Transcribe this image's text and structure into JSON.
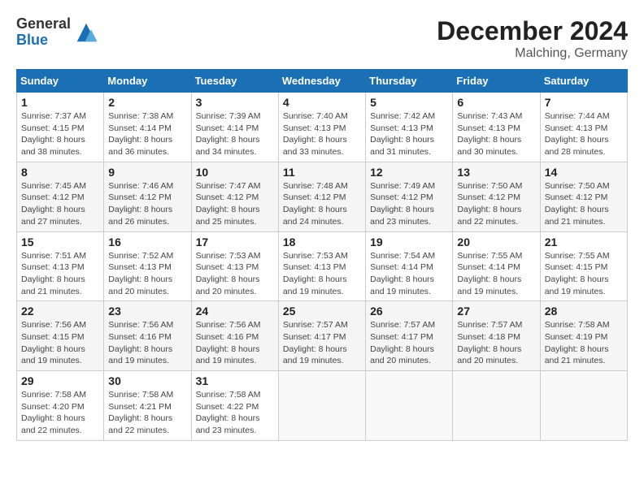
{
  "header": {
    "logo_general": "General",
    "logo_blue": "Blue",
    "month_year": "December 2024",
    "location": "Malching, Germany"
  },
  "days_of_week": [
    "Sunday",
    "Monday",
    "Tuesday",
    "Wednesday",
    "Thursday",
    "Friday",
    "Saturday"
  ],
  "weeks": [
    [
      {
        "day": "1",
        "sunrise": "Sunrise: 7:37 AM",
        "sunset": "Sunset: 4:15 PM",
        "daylight": "Daylight: 8 hours and 38 minutes."
      },
      {
        "day": "2",
        "sunrise": "Sunrise: 7:38 AM",
        "sunset": "Sunset: 4:14 PM",
        "daylight": "Daylight: 8 hours and 36 minutes."
      },
      {
        "day": "3",
        "sunrise": "Sunrise: 7:39 AM",
        "sunset": "Sunset: 4:14 PM",
        "daylight": "Daylight: 8 hours and 34 minutes."
      },
      {
        "day": "4",
        "sunrise": "Sunrise: 7:40 AM",
        "sunset": "Sunset: 4:13 PM",
        "daylight": "Daylight: 8 hours and 33 minutes."
      },
      {
        "day": "5",
        "sunrise": "Sunrise: 7:42 AM",
        "sunset": "Sunset: 4:13 PM",
        "daylight": "Daylight: 8 hours and 31 minutes."
      },
      {
        "day": "6",
        "sunrise": "Sunrise: 7:43 AM",
        "sunset": "Sunset: 4:13 PM",
        "daylight": "Daylight: 8 hours and 30 minutes."
      },
      {
        "day": "7",
        "sunrise": "Sunrise: 7:44 AM",
        "sunset": "Sunset: 4:13 PM",
        "daylight": "Daylight: 8 hours and 28 minutes."
      }
    ],
    [
      {
        "day": "8",
        "sunrise": "Sunrise: 7:45 AM",
        "sunset": "Sunset: 4:12 PM",
        "daylight": "Daylight: 8 hours and 27 minutes."
      },
      {
        "day": "9",
        "sunrise": "Sunrise: 7:46 AM",
        "sunset": "Sunset: 4:12 PM",
        "daylight": "Daylight: 8 hours and 26 minutes."
      },
      {
        "day": "10",
        "sunrise": "Sunrise: 7:47 AM",
        "sunset": "Sunset: 4:12 PM",
        "daylight": "Daylight: 8 hours and 25 minutes."
      },
      {
        "day": "11",
        "sunrise": "Sunrise: 7:48 AM",
        "sunset": "Sunset: 4:12 PM",
        "daylight": "Daylight: 8 hours and 24 minutes."
      },
      {
        "day": "12",
        "sunrise": "Sunrise: 7:49 AM",
        "sunset": "Sunset: 4:12 PM",
        "daylight": "Daylight: 8 hours and 23 minutes."
      },
      {
        "day": "13",
        "sunrise": "Sunrise: 7:50 AM",
        "sunset": "Sunset: 4:12 PM",
        "daylight": "Daylight: 8 hours and 22 minutes."
      },
      {
        "day": "14",
        "sunrise": "Sunrise: 7:50 AM",
        "sunset": "Sunset: 4:12 PM",
        "daylight": "Daylight: 8 hours and 21 minutes."
      }
    ],
    [
      {
        "day": "15",
        "sunrise": "Sunrise: 7:51 AM",
        "sunset": "Sunset: 4:13 PM",
        "daylight": "Daylight: 8 hours and 21 minutes."
      },
      {
        "day": "16",
        "sunrise": "Sunrise: 7:52 AM",
        "sunset": "Sunset: 4:13 PM",
        "daylight": "Daylight: 8 hours and 20 minutes."
      },
      {
        "day": "17",
        "sunrise": "Sunrise: 7:53 AM",
        "sunset": "Sunset: 4:13 PM",
        "daylight": "Daylight: 8 hours and 20 minutes."
      },
      {
        "day": "18",
        "sunrise": "Sunrise: 7:53 AM",
        "sunset": "Sunset: 4:13 PM",
        "daylight": "Daylight: 8 hours and 19 minutes."
      },
      {
        "day": "19",
        "sunrise": "Sunrise: 7:54 AM",
        "sunset": "Sunset: 4:14 PM",
        "daylight": "Daylight: 8 hours and 19 minutes."
      },
      {
        "day": "20",
        "sunrise": "Sunrise: 7:55 AM",
        "sunset": "Sunset: 4:14 PM",
        "daylight": "Daylight: 8 hours and 19 minutes."
      },
      {
        "day": "21",
        "sunrise": "Sunrise: 7:55 AM",
        "sunset": "Sunset: 4:15 PM",
        "daylight": "Daylight: 8 hours and 19 minutes."
      }
    ],
    [
      {
        "day": "22",
        "sunrise": "Sunrise: 7:56 AM",
        "sunset": "Sunset: 4:15 PM",
        "daylight": "Daylight: 8 hours and 19 minutes."
      },
      {
        "day": "23",
        "sunrise": "Sunrise: 7:56 AM",
        "sunset": "Sunset: 4:16 PM",
        "daylight": "Daylight: 8 hours and 19 minutes."
      },
      {
        "day": "24",
        "sunrise": "Sunrise: 7:56 AM",
        "sunset": "Sunset: 4:16 PM",
        "daylight": "Daylight: 8 hours and 19 minutes."
      },
      {
        "day": "25",
        "sunrise": "Sunrise: 7:57 AM",
        "sunset": "Sunset: 4:17 PM",
        "daylight": "Daylight: 8 hours and 19 minutes."
      },
      {
        "day": "26",
        "sunrise": "Sunrise: 7:57 AM",
        "sunset": "Sunset: 4:17 PM",
        "daylight": "Daylight: 8 hours and 20 minutes."
      },
      {
        "day": "27",
        "sunrise": "Sunrise: 7:57 AM",
        "sunset": "Sunset: 4:18 PM",
        "daylight": "Daylight: 8 hours and 20 minutes."
      },
      {
        "day": "28",
        "sunrise": "Sunrise: 7:58 AM",
        "sunset": "Sunset: 4:19 PM",
        "daylight": "Daylight: 8 hours and 21 minutes."
      }
    ],
    [
      {
        "day": "29",
        "sunrise": "Sunrise: 7:58 AM",
        "sunset": "Sunset: 4:20 PM",
        "daylight": "Daylight: 8 hours and 22 minutes."
      },
      {
        "day": "30",
        "sunrise": "Sunrise: 7:58 AM",
        "sunset": "Sunset: 4:21 PM",
        "daylight": "Daylight: 8 hours and 22 minutes."
      },
      {
        "day": "31",
        "sunrise": "Sunrise: 7:58 AM",
        "sunset": "Sunset: 4:22 PM",
        "daylight": "Daylight: 8 hours and 23 minutes."
      },
      null,
      null,
      null,
      null
    ]
  ]
}
